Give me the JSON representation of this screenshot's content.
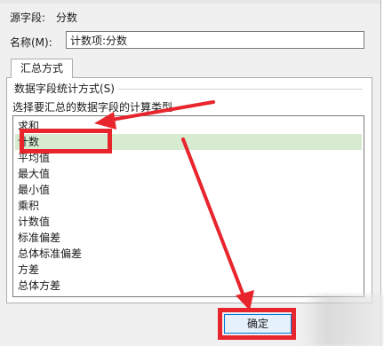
{
  "source_field": {
    "label": "源字段:",
    "value": "分数"
  },
  "name_field": {
    "label": "名称(M):",
    "value": "计数项:分数"
  },
  "tab": {
    "label": "汇总方式"
  },
  "group": {
    "title": "数据字段统计方式(S)",
    "instruction": "选择要汇总的数据字段的计算类型"
  },
  "list": {
    "items": [
      {
        "label": "求和"
      },
      {
        "label": "计数",
        "selected": true
      },
      {
        "label": "平均值"
      },
      {
        "label": "最大值"
      },
      {
        "label": "最小值"
      },
      {
        "label": "乘积"
      },
      {
        "label": "计数值"
      },
      {
        "label": "标准偏差"
      },
      {
        "label": "总体标准偏差"
      },
      {
        "label": "方差"
      },
      {
        "label": "总体方差"
      }
    ]
  },
  "buttons": {
    "ok": "确定"
  },
  "colors": {
    "annotation_red": "#e8242d",
    "selection": "#d7ebd1"
  }
}
